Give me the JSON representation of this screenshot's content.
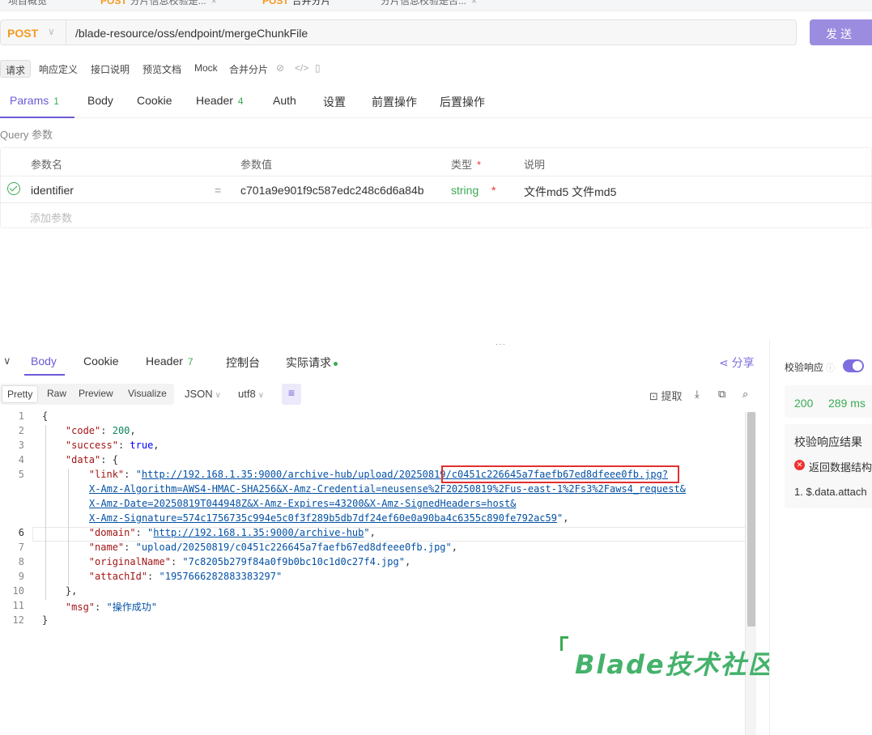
{
  "top_tabs": [
    {
      "label": "项目概览"
    },
    {
      "method": "POST",
      "label": "分片信息校验是..."
    },
    {
      "method": "POST",
      "label": "合并分片"
    },
    {
      "label": "分片信息校验是否..."
    }
  ],
  "request": {
    "method": "POST",
    "url": "/blade-resource/oss/endpoint/mergeChunkFile",
    "send_label": "发送"
  },
  "subtoolbar": {
    "items": [
      "请求",
      "响应定义",
      "接口说明",
      "预览文档",
      "Mock"
    ],
    "doc_name": "合并分片"
  },
  "param_tabs": [
    {
      "label": "Params",
      "count": "1"
    },
    {
      "label": "Body",
      "count": ""
    },
    {
      "label": "Cookie",
      "count": ""
    },
    {
      "label": "Header",
      "count": "4"
    },
    {
      "label": "Auth",
      "count": ""
    },
    {
      "label": "设置",
      "count": ""
    },
    {
      "label": "前置操作",
      "count": ""
    },
    {
      "label": "后置操作",
      "count": ""
    }
  ],
  "query": {
    "section_label": "Query 参数",
    "headers": {
      "name": "参数名",
      "value": "参数值",
      "type": "类型",
      "desc": "说明"
    },
    "required_mark": "*",
    "rows": [
      {
        "name": "identifier",
        "eq": "=",
        "value": "c701a9e901f9c587edc248c6d6a84b",
        "type": "string",
        "required": "*",
        "desc": "文件md5 文件md5"
      }
    ],
    "add_placeholder": "添加参数"
  },
  "splitter_glyph": "···",
  "response_tabs": [
    {
      "label": "Body",
      "count": ""
    },
    {
      "label": "Cookie",
      "count": ""
    },
    {
      "label": "Header",
      "count": "7"
    },
    {
      "label": "控制台",
      "count": ""
    },
    {
      "label": "实际请求",
      "count": ""
    }
  ],
  "share_label": "分享",
  "view_modes": [
    "Pretty",
    "Raw",
    "Preview",
    "Visualize"
  ],
  "format": "JSON",
  "encoding": "utf8",
  "extract_label": "提取",
  "code": {
    "line_numbers": [
      "1",
      "2",
      "3",
      "4",
      "5",
      "",
      "",
      "",
      "6",
      "7",
      "8",
      "9",
      "10",
      "11",
      "12"
    ],
    "code": "200",
    "success": "true",
    "link_l1": "http://192.168.1.35:9000/archive-hub/upload/20250819/c0451c226645a7faefb67ed8dfeee0fb.jpg?",
    "link_l2": "X-Amz-Algorithm=AWS4-HMAC-SHA256&X-Amz-Credential=neusense%2F20250819%2Fus-east-1%2Fs3%2Faws4_request&",
    "link_l3": "X-Amz-Date=20250819T044948Z&X-Amz-Expires=43200&X-Amz-SignedHeaders=host&",
    "link_l4": "X-Amz-Signature=574c1756735c994e5c0f3f289b5db7df24ef60e0a90ba4c6355c890fe792ac59",
    "domain": "http://192.168.1.35:9000/archive-hub",
    "name": "upload/20250819/c0451c226645a7faefb67ed8dfeee0fb.jpg",
    "originalName": "7c8205b279f84a0f9b0bc10c1d0c27f4.jpg",
    "attachId": "1957666282883383297",
    "msg": "操作成功"
  },
  "watermark": "Blade技术社区",
  "right_panel": {
    "validate_label": "校验响应",
    "status": "200",
    "time": "289 ms",
    "result_title": "校验响应结果",
    "error_text": "返回数据结构",
    "item_text": "1. $.data.attach"
  },
  "colors": {
    "accent": "#6b5bd6",
    "method_post": "#f59a23",
    "success_green": "#3aaa54",
    "error_red": "#e33333"
  }
}
